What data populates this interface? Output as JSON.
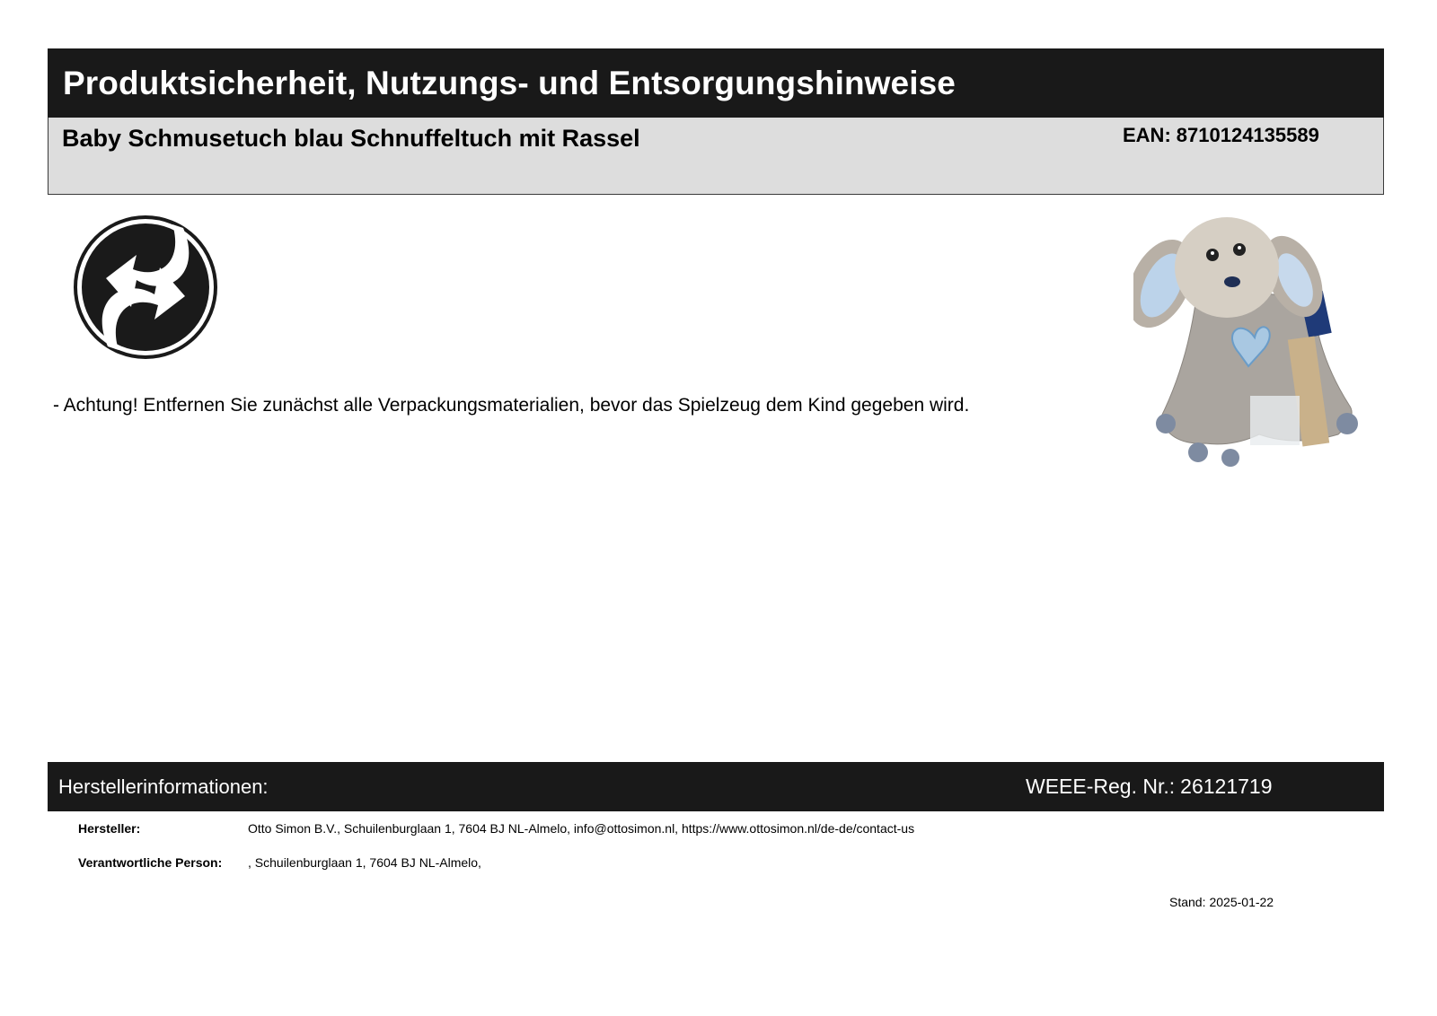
{
  "header": {
    "title": "Produktsicherheit, Nutzungs- und Entsorgungshinweise",
    "product_name": "Baby Schmusetuch blau Schnuffeltuch mit Rassel",
    "ean_label": "EAN:",
    "ean_value": "8710124135589"
  },
  "icons": {
    "recycling": "green-dot-recycling-icon",
    "product_image": "plush-dog-comforter-image"
  },
  "notes": {
    "warning": "- Achtung! Entfernen Sie zunächst alle Verpackungsmaterialien, bevor das Spielzeug dem Kind gegeben wird."
  },
  "manufacturer": {
    "heading": "Herstellerinformationen:",
    "weee_label": "WEEE-Reg. Nr.:",
    "weee_value": "26121719",
    "rows": [
      {
        "label": "Hersteller:",
        "value": "Otto Simon B.V., Schuilenburglaan 1, 7604 BJ NL-Almelo, info@ottosimon.nl, https://www.ottosimon.nl/de-de/contact-us"
      },
      {
        "label": "Verantwortliche Person:",
        "value": ", Schuilenburglaan 1, 7604 BJ NL-Almelo,"
      }
    ]
  },
  "footer": {
    "stand_label": "Stand:",
    "stand_value": "2025-01-22"
  },
  "colors": {
    "bar_background": "#191919",
    "product_box_background": "#dddddd"
  }
}
